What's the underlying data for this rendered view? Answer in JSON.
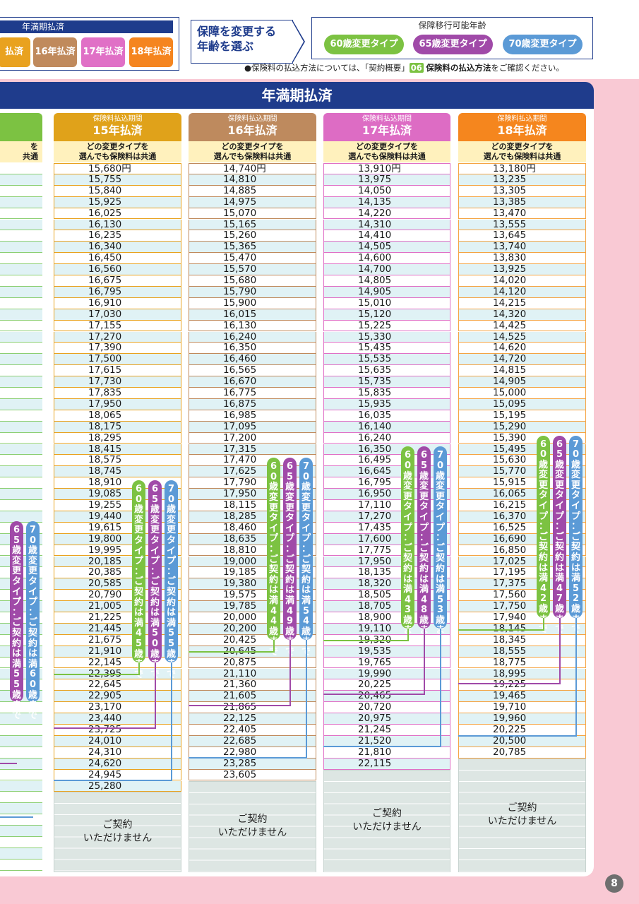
{
  "legend": {
    "title": "年満期払済",
    "chips": [
      {
        "label": "払済",
        "color": "#e9a21f"
      },
      {
        "label": "16年払済",
        "color": "#c08a5c"
      },
      {
        "label": "17年払済",
        "color": "#e070c6"
      },
      {
        "label": "18年払済",
        "color": "#f5851f"
      }
    ]
  },
  "change_box": {
    "line1": "保障を変更する",
    "line2": "年齢を選ぶ"
  },
  "move_box": {
    "title": "保障移行可能年齢",
    "pills": [
      {
        "label": "60歳変更タイプ",
        "color": "#7cc242"
      },
      {
        "label": "65歳変更タイプ",
        "color": "#a04aa8"
      },
      {
        "label": "70歳変更タイプ",
        "color": "#5b9ad6"
      }
    ]
  },
  "note": {
    "before": "●保険料の払込方法については、「契約概要」",
    "badge": "06",
    "bold": "保険料の払込方法",
    "after": "をご確認ください。"
  },
  "banner": "年満期払済",
  "stub": {
    "sub_line1": "を",
    "sub_line2": "共通",
    "tag65": "65歳変更タイプ：ご契約は満55歳まで",
    "tag70": "70歳変更タイプ：ご契約は満60歳まで"
  },
  "not_available": {
    "line1": "ご契約",
    "line2": "いただけません"
  },
  "columns": [
    {
      "period_label": "保険料払込期間",
      "years_label": "15年払済",
      "sub_line1": "どの変更タイプを",
      "sub_line2": "選んでも保険料は共通",
      "header_color": "#e0a21a",
      "line_color": "#e9a21f",
      "values": [
        "15,680円",
        "15,755",
        "15,840",
        "15,925",
        "16,025",
        "16,130",
        "16,235",
        "16,340",
        "16,450",
        "16,560",
        "16,675",
        "16,795",
        "16,910",
        "17,030",
        "17,155",
        "17,270",
        "17,390",
        "17,500",
        "17,615",
        "17,730",
        "17,835",
        "17,950",
        "18,065",
        "18,175",
        "18,295",
        "18,415",
        "18,575",
        "18,745",
        "18,910",
        "19,085",
        "19,255",
        "19,440",
        "19,615",
        "19,800",
        "19,995",
        "20,185",
        "20,385",
        "20,585",
        "20,790",
        "21,005",
        "21,225",
        "21,445",
        "21,675",
        "21,910",
        "22,145",
        "22,395",
        "22,645",
        "22,905",
        "23,170",
        "23,440",
        "23,725",
        "24,010",
        "24,310",
        "24,620",
        "24,945",
        "25,280"
      ],
      "tag60": "60歳変更タイプ：ご契約は満45歳まで",
      "tag65": "65歳変更タイプ：ご契約は満50歳まで",
      "tag70": "70歳変更タイプ：ご契約は満55歳まで"
    },
    {
      "period_label": "保険料払込期間",
      "years_label": "16年払済",
      "sub_line1": "どの変更タイプを",
      "sub_line2": "選んでも保険料は共通",
      "header_color": "#be8a5e",
      "line_color": "#c08a5c",
      "values": [
        "14,740円",
        "14,810",
        "14,885",
        "14,975",
        "15,070",
        "15,165",
        "15,260",
        "15,365",
        "15,470",
        "15,570",
        "15,680",
        "15,790",
        "15,900",
        "16,015",
        "16,130",
        "16,240",
        "16,350",
        "16,460",
        "16,565",
        "16,670",
        "16,775",
        "16,875",
        "16,985",
        "17,095",
        "17,200",
        "17,315",
        "17,470",
        "17,625",
        "17,790",
        "17,950",
        "18,115",
        "18,285",
        "18,460",
        "18,635",
        "18,810",
        "19,000",
        "19,185",
        "19,380",
        "19,575",
        "19,785",
        "20,000",
        "20,200",
        "20,425",
        "20,645",
        "20,875",
        "21,110",
        "21,360",
        "21,605",
        "21,865",
        "22,125",
        "22,405",
        "22,685",
        "22,980",
        "23,285",
        "23,605"
      ],
      "tag60": "60歳変更タイプ：ご契約は満44歳まで",
      "tag65": "65歳変更タイプ：ご契約は満49歳まで",
      "tag70": "70歳変更タイプ：ご契約は満54歳まで"
    },
    {
      "period_label": "保険料払込期間",
      "years_label": "17年払済",
      "sub_line1": "どの変更タイプを",
      "sub_line2": "選んでも保険料は共通",
      "header_color": "#dd6cc4",
      "line_color": "#e070c6",
      "values": [
        "13,910円",
        "13,975",
        "14,050",
        "14,135",
        "14,220",
        "14,310",
        "14,410",
        "14,505",
        "14,600",
        "14,700",
        "14,805",
        "14,905",
        "15,010",
        "15,120",
        "15,225",
        "15,330",
        "15,435",
        "15,535",
        "15,635",
        "15,735",
        "15,835",
        "15,935",
        "16,035",
        "16,140",
        "16,240",
        "16,350",
        "16,495",
        "16,645",
        "16,795",
        "16,950",
        "17,110",
        "17,270",
        "17,435",
        "17,600",
        "17,775",
        "17,950",
        "18,135",
        "18,320",
        "18,505",
        "18,705",
        "18,900",
        "19,110",
        "19,320",
        "19,535",
        "19,765",
        "19,990",
        "20,225",
        "20,465",
        "20,720",
        "20,975",
        "21,245",
        "21,520",
        "21,810",
        "22,115"
      ],
      "tag60": "60歳変更タイプ：ご契約は満43歳まで",
      "tag65": "65歳変更タイプ：ご契約は満48歳まで",
      "tag70": "70歳変更タイプ：ご契約は満53歳まで"
    },
    {
      "period_label": "保険料払込期間",
      "years_label": "18年払済",
      "sub_line1": "どの変更タイプを",
      "sub_line2": "選んでも保険料は共通",
      "header_color": "#f5861e",
      "line_color": "#f5a443",
      "values": [
        "13,180円",
        "13,235",
        "13,305",
        "13,385",
        "13,470",
        "13,555",
        "13,645",
        "13,740",
        "13,830",
        "13,925",
        "14,020",
        "14,120",
        "14,215",
        "14,320",
        "14,425",
        "14,525",
        "14,620",
        "14,720",
        "14,815",
        "14,905",
        "15,000",
        "15,095",
        "15,195",
        "15,290",
        "15,390",
        "15,495",
        "15,630",
        "15,770",
        "15,915",
        "16,065",
        "16,215",
        "16,370",
        "16,525",
        "16,690",
        "16,850",
        "17,025",
        "17,195",
        "17,375",
        "17,560",
        "17,750",
        "17,940",
        "18,145",
        "18,345",
        "18,555",
        "18,775",
        "18,995",
        "19,225",
        "19,465",
        "19,710",
        "19,960",
        "20,225",
        "20,500",
        "20,785"
      ],
      "tag60": "60歳変更タイプ：ご契約は満42歳まで",
      "tag65": "65歳変更タイプ：ご契約は満47歳まで",
      "tag70": "70歳変更タイプ：ご契約は満52歳まで"
    }
  ]
}
